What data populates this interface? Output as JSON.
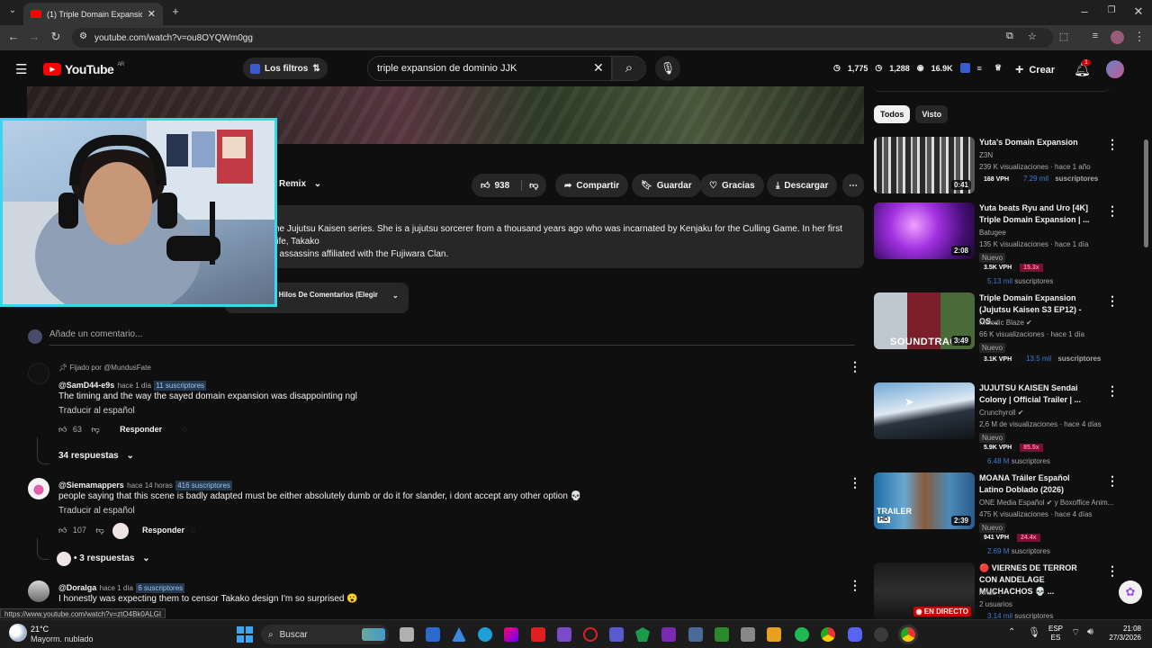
{
  "browser": {
    "tab_title": "(1) Triple Domain Expansion ar",
    "url": "youtube.com/watch?v=ou8OYQWm0gg"
  },
  "header": {
    "logo_text": "YouTube",
    "region": "AR",
    "filters_label": "Los filtros",
    "search_value": "triple expansion de dominio JJK",
    "stats": [
      "1,775",
      "1,288",
      "16.9K"
    ],
    "create_label": "Crear",
    "notif_count": "1"
  },
  "video": {
    "remix_label": "Remix",
    "likes": "938",
    "share_label": "Compartir",
    "save_label": "Guardar",
    "thanks_label": "Gracias",
    "download_label": "Descargar",
    "description_line1": "he Jujutsu Kaisen series. She is a jujutsu sorcerer from a thousand years ago who was incarnated by Kenjaku for the Culling Game. In her first life, Takako",
    "description_line2": "f assassins affiliated with the Fujiwara Clan.",
    "sort_label": "s Hilos De Comentarios (Elegir"
  },
  "comments": {
    "add_placeholder": "Añade un comentario...",
    "items": [
      {
        "pinned": "Fijado por @MundusFate",
        "author": "@SamD44-e9s",
        "time": "hace 1 día",
        "subs": "11 suscriptores",
        "text": "The timing and the way the sayed domain expansion was disappointing ngl",
        "translate": "Traducir al español",
        "likes": "63",
        "reply": "Responder",
        "replies": "34 respuestas"
      },
      {
        "author": "@Siemamappers",
        "time": "hace 14 horas",
        "subs": "416 suscriptores",
        "text": "people saying that this scene is badly adapted must be either absolutely dumb or do it for slander, i dont accept any other option 💀",
        "translate": "Traducir al español",
        "likes": "107",
        "reply": "Responder",
        "replies": "• 3 respuestas"
      },
      {
        "author": "@Doralga",
        "time": "hace 1 día",
        "subs": "6 suscriptores",
        "text": "I honestly was expecting them to censor Takako design I'm so surprised 😮"
      }
    ]
  },
  "sidebar": {
    "chips": [
      "Todos",
      "Visto"
    ],
    "videos": [
      {
        "title": "Yuta's Domain Expansion",
        "channel": "Z3N",
        "views": "239 K visualizaciones",
        "age": "hace 1 año",
        "duration": "0:41",
        "vph": "168 VPH",
        "subs": "7.29 mil",
        "subs_suffix": "suscriptores"
      },
      {
        "title": "Yuta beats Ryu and Uro [4K] Triple Domain Expansion | ...",
        "channel": "Batugee",
        "views": "135 K visualizaciones",
        "age": "hace 1 día",
        "duration": "2:08",
        "badge": "Nuevo",
        "vph": "3.5K VPH",
        "ratio": "15.3x",
        "subs": "5.13 mil",
        "subs_suffix": "suscriptores"
      },
      {
        "title": "Triple Domain Expansion (Jujutsu Kaisen S3 EP12) - OS...",
        "channel": "Melodic Blaze",
        "views": "66 K visualizaciones",
        "age": "hace 1 día",
        "duration": "3:49",
        "thumb_text": "SOUNDTRACK",
        "badge": "Nuevo",
        "vph": "3.1K VPH",
        "subs": "13.5 mil",
        "subs_suffix": "suscriptores"
      },
      {
        "title": "JUJUTSU KAISEN Sendai Colony | Official Trailer | ...",
        "channel": "Crunchyroll",
        "views": "2,6 M de visualizaciones",
        "age": "hace 4 días",
        "badge": "Nuevo",
        "vph": "5.9K VPH",
        "ratio": "85.5x",
        "subs": "6.48 M",
        "subs_suffix": "suscriptores"
      },
      {
        "title": "MOANA Tráiler Español Latino Doblado (2026)",
        "channel": "ONE Media Español",
        "channel_extra": "y Boxoffice Anim...",
        "views": "475 K visualizaciones",
        "age": "hace 4 días",
        "duration": "2:39",
        "thumb_text": "TRAILER",
        "thumb_badge": "HD",
        "badge": "Nuevo",
        "vph": "941 VPH",
        "ratio": "24.4x",
        "subs": "2.69 M",
        "subs_suffix": "suscriptores"
      },
      {
        "title": "🔴 VIERNES DE TERROR CON ANDELAGE MUCHACHOS 💀 ...",
        "channel": "Ande",
        "views": "2 usuarios",
        "live": "EN DIRECTO",
        "subs": "3.14 mil",
        "subs_suffix": "suscriptores"
      }
    ]
  },
  "statusbar": {
    "url": "https://www.youtube.com/watch?v=ztO4Bk0ALGI"
  },
  "taskbar": {
    "weather_temp": "21°C",
    "weather_desc": "Mayorm. nublado",
    "search_label": "Buscar",
    "lang1": "ESP",
    "lang2": "ES",
    "time": "21:08",
    "date": "27/3/2026"
  },
  "colors": {
    "accent": "#ff0000",
    "webcam_border": "#35d8ee",
    "subs_blue": "#3e7bd6"
  }
}
